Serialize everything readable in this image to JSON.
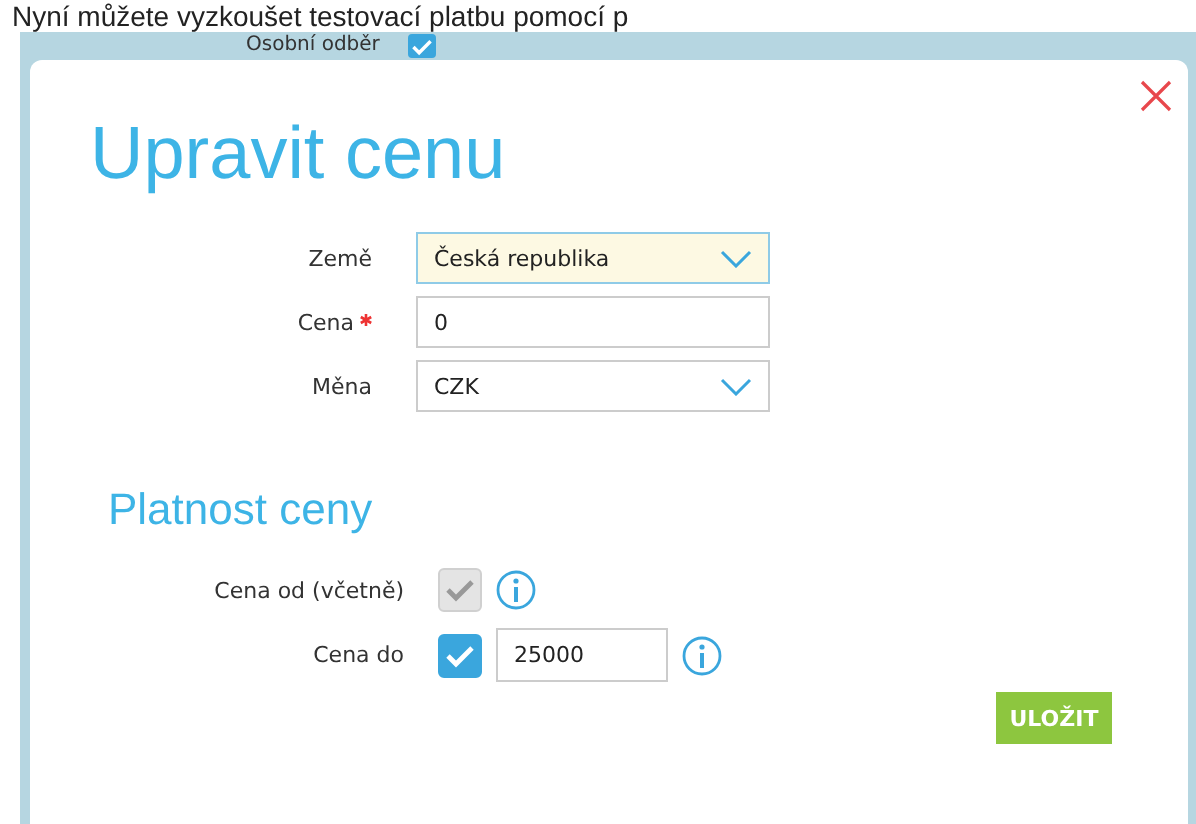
{
  "background": {
    "heading": "Nyní můžete vyzkoušet testovací platbu pomocí p",
    "label": "Osobní odběr",
    "checkbox": {
      "checked": true
    }
  },
  "dialog": {
    "title": "Upravit cenu",
    "fields": [
      {
        "kind": "select",
        "label": "Země",
        "required": false,
        "value": "Česká republika",
        "highlighted": true
      },
      {
        "kind": "input",
        "label": "Cena",
        "required": true,
        "value": "0",
        "highlighted": false
      },
      {
        "kind": "select",
        "label": "Měna",
        "required": false,
        "value": "CZK",
        "highlighted": false
      }
    ],
    "section_title": "Platnost ceny",
    "validity": [
      {
        "label": "Cena od (včetně)",
        "checked": true,
        "disabled": true
      },
      {
        "label": "Cena do",
        "checked": true,
        "disabled": false,
        "value": "25000"
      }
    ],
    "save_button": "ULOŽIT"
  }
}
